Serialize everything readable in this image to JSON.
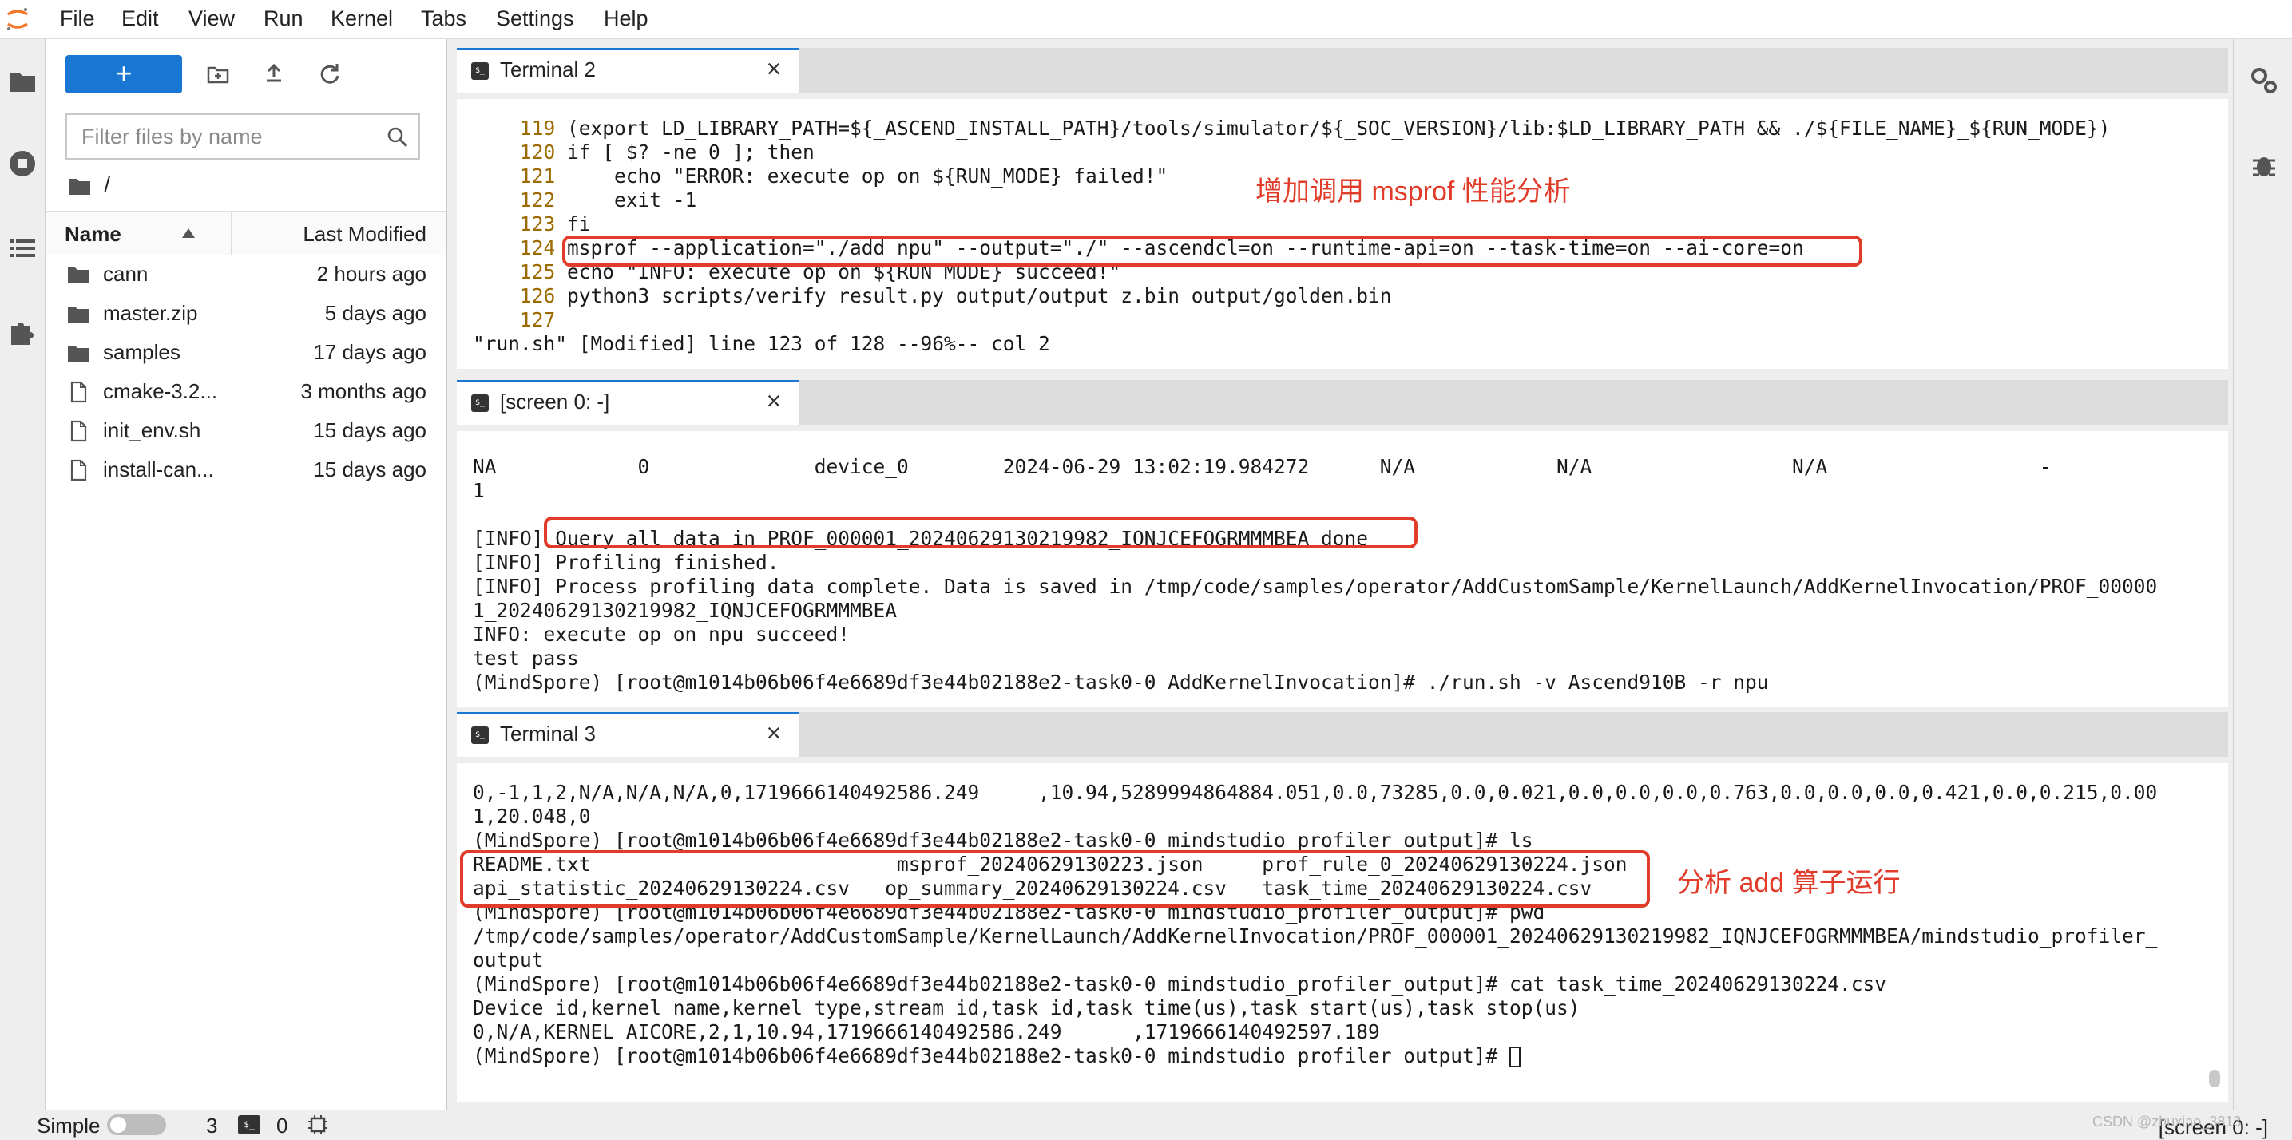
{
  "menu": [
    "File",
    "Edit",
    "View",
    "Run",
    "Kernel",
    "Tabs",
    "Settings",
    "Help"
  ],
  "filebrowser": {
    "new_label": "+",
    "filter_placeholder": "Filter files by name",
    "breadcrumb": "/",
    "col_name": "Name",
    "col_modified": "Last Modified",
    "files": [
      {
        "name": "cann",
        "modified": "2 hours ago",
        "type": "folder"
      },
      {
        "name": "master.zip",
        "modified": "5 days ago",
        "type": "folder"
      },
      {
        "name": "samples",
        "modified": "17 days ago",
        "type": "folder"
      },
      {
        "name": "cmake-3.2...",
        "modified": "3 months ago",
        "type": "file"
      },
      {
        "name": "init_env.sh",
        "modified": "15 days ago",
        "type": "file"
      },
      {
        "name": "install-can...",
        "modified": "15 days ago",
        "type": "file"
      }
    ]
  },
  "terminals": [
    {
      "tab": "Terminal 2",
      "lines": [
        {
          "n": "119",
          "t": " (export LD_LIBRARY_PATH=${_ASCEND_INSTALL_PATH}/tools/simulator/${_SOC_VERSION}/lib:$LD_LIBRARY_PATH && ./${FILE_NAME}_${RUN_MODE})"
        },
        {
          "n": "120",
          "t": " if [ $? -ne 0 ]; then"
        },
        {
          "n": "121",
          "t": "     echo \"ERROR: execute op on ${RUN_MODE} failed!\""
        },
        {
          "n": "122",
          "t": "     exit -1"
        },
        {
          "n": "123",
          "t": " fi"
        },
        {
          "n": "124",
          "t": " msprof --application=\"./add_npu\" --output=\"./\" --ascendcl=on --runtime-api=on --task-time=on --ai-core=on"
        },
        {
          "n": "125",
          "t": " echo \"INFO: execute op on ${RUN_MODE} succeed!\""
        },
        {
          "n": "126",
          "t": " python3 scripts/verify_result.py output/output_z.bin output/golden.bin"
        },
        {
          "n": "127",
          "t": ""
        },
        {
          "n": "",
          "t": "\"run.sh\" [Modified] line 123 of 128 --96%-- col 2"
        }
      ],
      "annotation": "增加调用 msprof 性能分析"
    },
    {
      "tab": "[screen 0: -]",
      "lines": [
        "NA            0              device_0        2024-06-29 13:02:19.984272      N/A            N/A                 N/A                  -",
        "1",
        "",
        "[INFO] Query all data in PROF_000001_20240629130219982_IQNJCEFOGRMMMBEA done",
        "[INFO] Profiling finished.",
        "[INFO] Process profiling data complete. Data is saved in /tmp/code/samples/operator/AddCustomSample/KernelLaunch/AddKernelInvocation/PROF_00000",
        "1_20240629130219982_IQNJCEFOGRMMMBEA",
        "INFO: execute op on npu succeed!",
        "test pass",
        "(MindSpore) [root@m1014b06b06f4e6689df3e44b02188e2-task0-0 AddKernelInvocation]# ./run.sh -v Ascend910B -r npu"
      ]
    },
    {
      "tab": "Terminal 3",
      "lines": [
        "0,-1,1,2,N/A,N/A,N/A,0,1719666140492586.249     ,10.94,5289994864884.051,0.0,73285,0.0,0.021,0.0,0.0,0.0,0.763,0.0,0.0,0.0,0.421,0.0,0.215,0.00",
        "1,20.048,0",
        "(MindSpore) [root@m1014b06b06f4e6689df3e44b02188e2-task0-0 mindstudio_profiler_output]# ls",
        "README.txt                          msprof_20240629130223.json     prof_rule_0_20240629130224.json",
        "api_statistic_20240629130224.csv   op_summary_20240629130224.csv   task_time_20240629130224.csv",
        "(MindSpore) [root@m1014b06b06f4e6689df3e44b02188e2-task0-0 mindstudio_profiler_output]# pwd",
        "/tmp/code/samples/operator/AddCustomSample/KernelLaunch/AddKernelInvocation/PROF_000001_20240629130219982_IQNJCEFOGRMMMBEA/mindstudio_profiler_",
        "output",
        "(MindSpore) [root@m1014b06b06f4e6689df3e44b02188e2-task0-0 mindstudio_profiler_output]# cat task_time_20240629130224.csv",
        "Device_id,kernel_name,kernel_type,stream_id,task_id,task_time(us),task_start(us),task_stop(us)",
        "0,N/A,KERNEL_AICORE,2,1,10.94,1719666140492586.249      ,1719666140492597.189",
        "(MindSpore) [root@m1014b06b06f4e6689df3e44b02188e2-task0-0 mindstudio_profiler_output]# "
      ],
      "annotation": "分析 add 算子运行"
    }
  ],
  "status": {
    "mode": "Simple",
    "kernels": "3",
    "terminals": "0",
    "right_label": "[screen 0: -]",
    "watermark": "CSDN @zhuxiao_3813"
  }
}
